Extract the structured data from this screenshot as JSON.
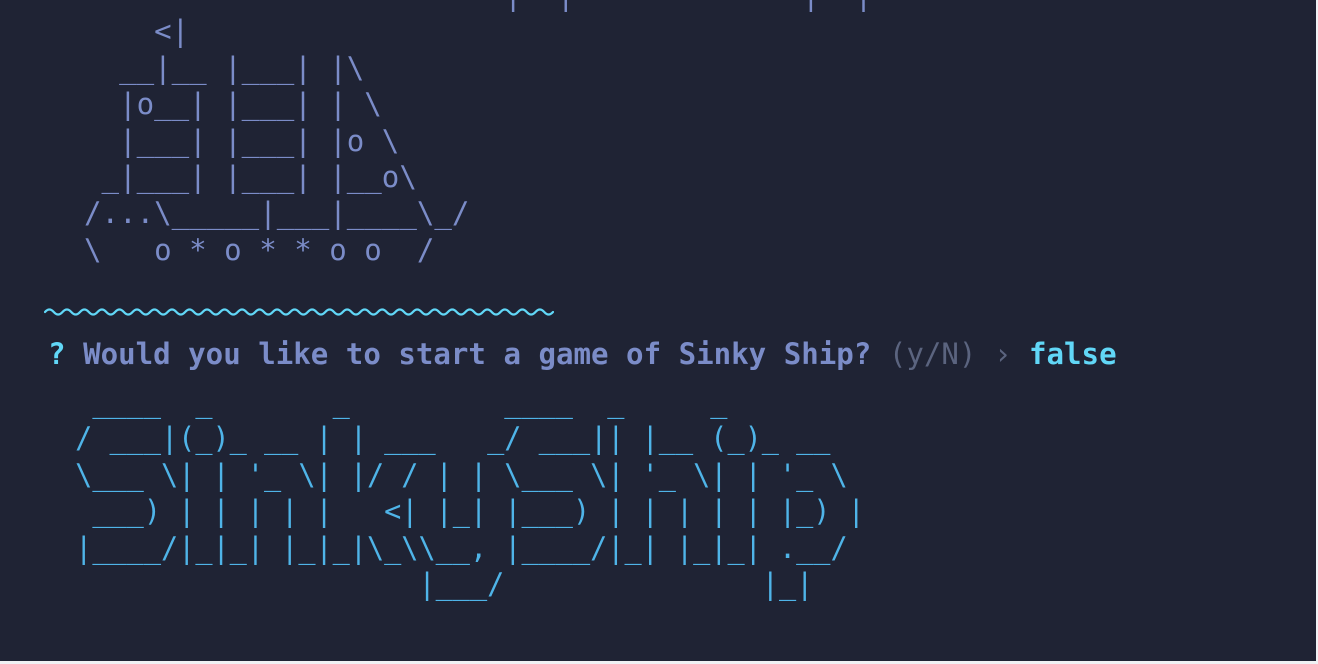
{
  "terminal": {
    "ship_art": [
      "                          |  |             |  |",
      "      <|",
      "    __|__ |___| |\\",
      "    |o__| |___| | \\",
      "    |___| |___| |o \\",
      "   _|___| |___| |__o\\",
      "  /...\\_____|___|____\\_/",
      "  \\   o * o * * o o  /"
    ],
    "waves": "~~~~~~~~~~~~~~~~~~~~~~~~~~~~~",
    "prompt": {
      "mark": "?",
      "question": "Would you like to start a game of Sinky Ship?",
      "hint": "(y/N)",
      "arrow": "›",
      "answer": "false"
    },
    "banner_art": [
      "  ____  _       _         ____  _     _",
      " / ___|(_)_ __ | | ___   _/ ___|| |__ (_)_ __",
      " \\___ \\| | '_ \\| |/ / | | \\___ \\| '_ \\| | '_ \\",
      "  ___) | | | | |   <| |_| |___) | | | | | |_) |",
      " |____/|_|_| |_|_|\\_\\\\__, |____/|_| |_|_| .__/",
      "                     |___/               |_|"
    ],
    "colors": {
      "background": "#1f2334",
      "ship": "#7b8cc8",
      "waves": "#61d7f7",
      "prompt_question": "#7b8cc8",
      "prompt_hint": "#5b647f",
      "prompt_answer": "#61d7f7",
      "banner": "#4fb4e8"
    }
  }
}
